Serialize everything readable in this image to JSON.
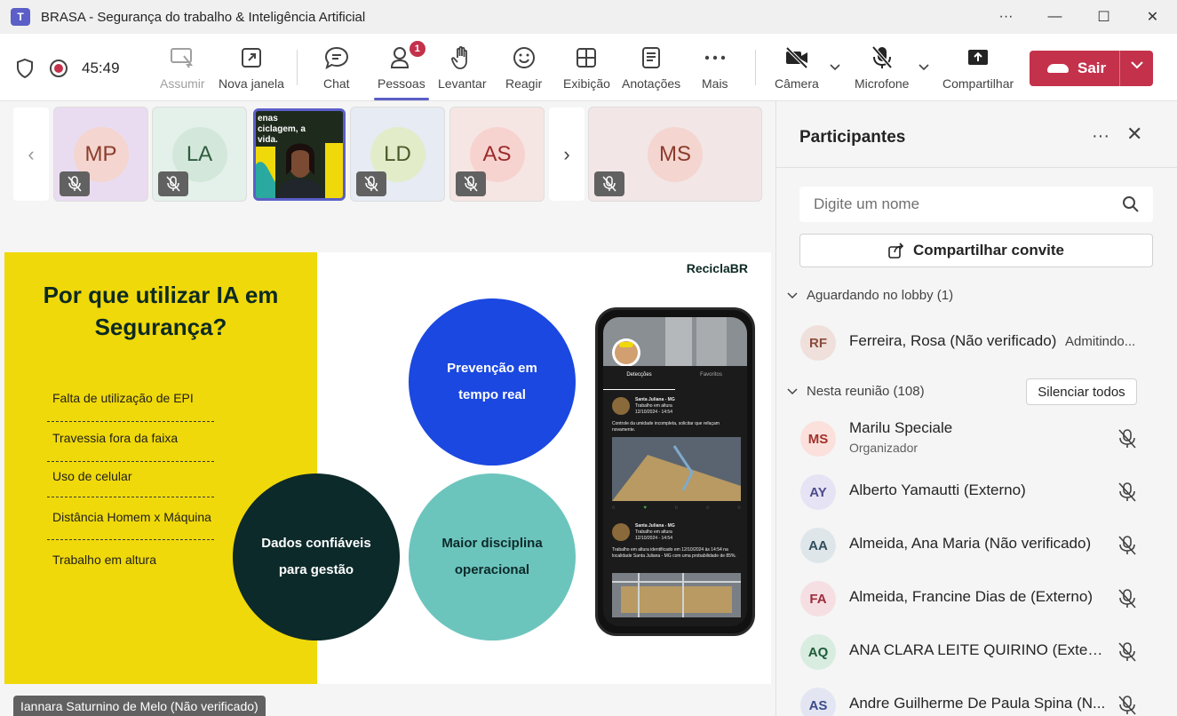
{
  "window": {
    "app_letter": "T",
    "title": "BRASA - Segurança do trabalho & Inteligência Artificial",
    "more": "···",
    "minimize": "—",
    "maximize": "☐",
    "close": "✕"
  },
  "toolbar": {
    "timer": "45:49",
    "items": {
      "assumir": "Assumir",
      "nova_janela": "Nova janela",
      "chat": "Chat",
      "pessoas": "Pessoas",
      "levantar": "Levantar",
      "reagir": "Reagir",
      "exibicao": "Exibição",
      "anotacoes": "Anotações",
      "mais": "Mais",
      "camera": "Câmera",
      "microfone": "Microfone",
      "compartilhar": "Compartilhar"
    },
    "people_badge": "1",
    "leave_label": "Sair"
  },
  "stage": {
    "tiles": [
      {
        "initials": "MP",
        "bg": "#eadcf0",
        "fg": "#8a3b2b",
        "circle": "#f4d5cf"
      },
      {
        "initials": "LA",
        "bg": "#e4f0ea",
        "fg": "#2f5b3f",
        "circle": "#d3e8da"
      },
      {
        "initials": "LD",
        "bg": "#e6ebf4",
        "fg": "#4a5a2a",
        "circle": "#e3ecc9"
      },
      {
        "initials": "AS",
        "bg": "#f6e6e3",
        "fg": "#9b2c2c",
        "circle": "#f7d3d0"
      },
      {
        "initials": "MS",
        "bg": "#f2e6e6",
        "fg": "#8a3b2b",
        "circle": "#f4d5cf"
      }
    ],
    "video_caption": "enas ciclagem, a vida.",
    "speaker_name": "Iannara Saturnino de Melo (Não verificado)"
  },
  "slide": {
    "title": "Por que utilizar IA em Segurança?",
    "bullets": [
      "Falta de utilização de EPI",
      "Travessia fora da faixa",
      "Uso de celular",
      "Distância Homem x Máquina",
      "Trabalho em altura"
    ],
    "logo": "ReciclaBR",
    "circles": {
      "prevencao": "Prevenção em tempo real",
      "dados": "Dados confiáveis para gestão",
      "disciplina": "Maior disciplina operacional"
    },
    "phone": {
      "tab_active": "Detecções",
      "tab_other": "Favoritos",
      "post1_title": "Santa Juliana - MG",
      "post1_sub": "Trabalho em altura",
      "post1_date": "12/10/2024 - 14:54",
      "post1_text": "Controle da umidade incompleta, solicitar que refaçam novamente.",
      "post2_title": "Santa Juliana - MG",
      "post2_sub": "Trabalho em altura",
      "post2_date": "12/10/2024 - 14:54",
      "post2_text": "Trabalho em altura identificado em 12/10/2024 às 14:54 na localidade Santa Juliana - MG com uma probabilidade de 85%."
    },
    "colors": {
      "yellow": "#f0d90a",
      "blue": "#1b48e0",
      "dark": "#0d2a2a",
      "teal": "#6cc5bd"
    }
  },
  "panel": {
    "title": "Participantes",
    "more": "···",
    "close": "✕",
    "search_placeholder": "Digite um nome",
    "invite_label": "Compartilhar convite",
    "lobby_section": "Aguardando no lobby (1)",
    "meeting_section": "Nesta reunião (108)",
    "mute_all": "Silenciar todos",
    "lobby": [
      {
        "initials": "RF",
        "name": "Ferreira, Rosa (Não verificado)",
        "status": "Admitindo...",
        "bg": "#efe0dc",
        "fg": "#8a4b3b"
      }
    ],
    "participants": [
      {
        "initials": "MS",
        "name": "Marilu Speciale",
        "role": "Organizador",
        "bg": "#fbe0dc",
        "fg": "#a0332b"
      },
      {
        "initials": "AY",
        "name": "Alberto Yamautti (Externo)",
        "role": "",
        "bg": "#e6e3f5",
        "fg": "#4b4b8a"
      },
      {
        "initials": "AA",
        "name": "Almeida, Ana Maria (Não verificado)",
        "role": "",
        "bg": "#dfe6ea",
        "fg": "#2f4b5b"
      },
      {
        "initials": "FA",
        "name": "Almeida, Francine Dias de (Externo)",
        "role": "",
        "bg": "#f6dfe2",
        "fg": "#9b2c3c"
      },
      {
        "initials": "AQ",
        "name": "ANA CLARA LEITE QUIRINO (Externo)",
        "role": "",
        "bg": "#d8ece0",
        "fg": "#1f5b3a"
      },
      {
        "initials": "AS",
        "name": "Andre Guilherme De Paula Spina (N...",
        "role": "",
        "bg": "#e3e6f2",
        "fg": "#3b4b8a"
      }
    ]
  }
}
